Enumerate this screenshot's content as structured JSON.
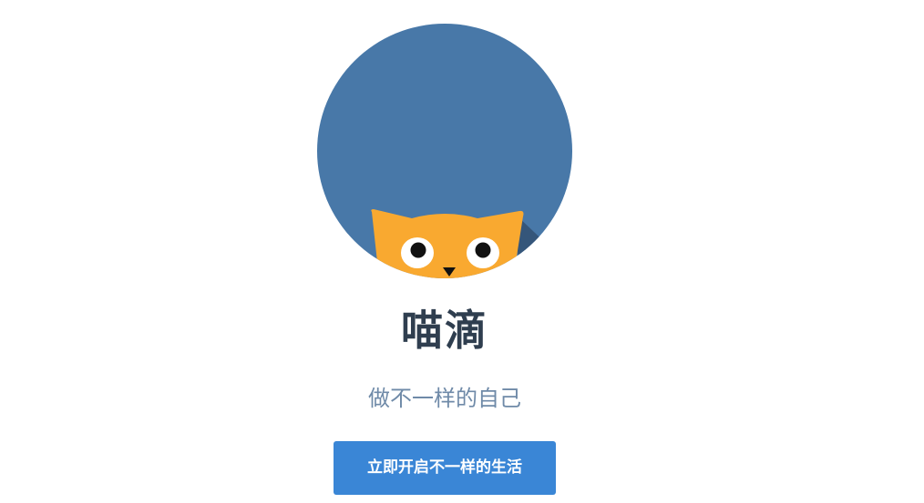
{
  "brand": {
    "name": "喵滴",
    "tagline": "做不一样的自己",
    "logo_icon": "cat-peeking-icon"
  },
  "cta": {
    "label": "立即开启不一样的生活"
  },
  "colors": {
    "logo_circle": "#4878a8",
    "logo_shadow": "#35567a",
    "cat_fur": "#f9a930",
    "title": "#2f3e4f",
    "tagline": "#6f8aa8",
    "button": "#3a86d6",
    "button_text": "#ffffff"
  }
}
